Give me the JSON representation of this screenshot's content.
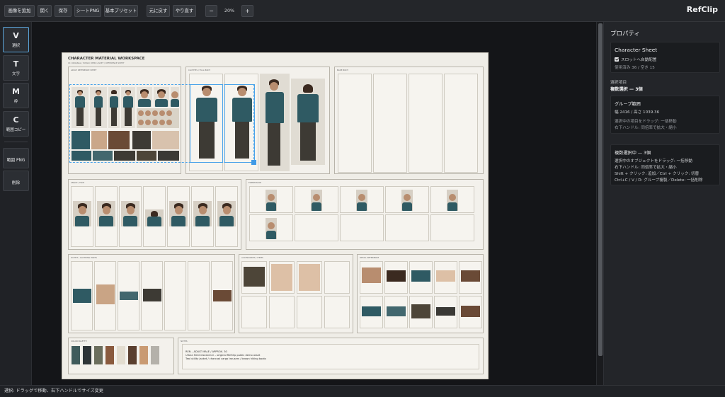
{
  "toolbar": {
    "add_image": "画像を追加",
    "open": "開く",
    "save": "保存",
    "sheet_png": "シートPNG",
    "preset": "基本プリセット",
    "undo": "元に戻す",
    "redo": "やり直す",
    "zoom_out": "−",
    "zoom_value": "20%",
    "zoom_in": "+"
  },
  "brand": "RefClip",
  "tools": [
    {
      "key": "V",
      "label": "選択"
    },
    {
      "key": "T",
      "label": "文字"
    },
    {
      "key": "M",
      "label": "枠"
    },
    {
      "key": "C",
      "label": "範囲コピー"
    }
  ],
  "tool_actions": {
    "range_png": "範囲 PNG",
    "delete": "削除"
  },
  "sheet": {
    "title": "CHARACTER MATERIAL WORKSPACE",
    "subtitle": "ID: ORIGINAL / PUBLIC DEMO ASSET / REFERENCE SHEET",
    "panels": {
      "contact": "ADULT REFERENCE SHEET",
      "clothes": "CLOTHES / FULL BODY",
      "base": "BASE BODY",
      "angle": "ANGLE / FACE",
      "expression": "EXPRESSION",
      "outfit": "OUTFIT / CLOTHING PARTS",
      "accessories": "ACCESSORIES / ITEMS",
      "detail": "DETAIL REFERENCE",
      "palette": "COLOR PALETTE",
      "notes": "NOTES"
    },
    "notes_lines": [
      "REN – ADULT MALE / APPROX. 30",
      "Urban field researcher – original RefClip public demo asset",
      "Teal utility jacket / charcoal cargo trousers / brown hiking boots"
    ],
    "palette_colors": [
      "#3f5b5c",
      "#2e3538",
      "#6b6e5d",
      "#8a5a3e",
      "#e3ddd0",
      "#5a3f2f",
      "#c99a72",
      "#b4b1aa"
    ]
  },
  "properties": {
    "title": "プロパティ",
    "sheet_card": {
      "heading": "Character Sheet",
      "auto_layout": "スロットへ自動配置",
      "usage": "使用済み 36 / 空き 15"
    },
    "selection_label": "選択項目",
    "selection_value": "複数選択 — 3個",
    "group_card": {
      "heading": "グループ範囲",
      "size": "幅 2416 / 高さ 1039.36",
      "hint1": "選択中の項目をドラッグ: 一括移動",
      "hint2": "右下ハンドル: 同倍率で拡大・縮小"
    },
    "multi_card": {
      "heading": "複数選択中 — 3個",
      "lines": [
        "選択中のオブジェクトをドラッグ: 一括移動",
        "右下ハンドル: 同倍率で拡大・縮小",
        "Shift + クリック: 追加／Ctrl + クリック: 切替",
        "Ctrl+C / V / D: グループ複製／Delete: 一括削除"
      ]
    }
  },
  "status": "選択: ドラッグで移動、右下ハンドルでサイズ変更",
  "colors": {
    "accent": "#4aa3ea",
    "sheet_bg": "#efede7",
    "jacket_teal": "#2f5a63"
  }
}
